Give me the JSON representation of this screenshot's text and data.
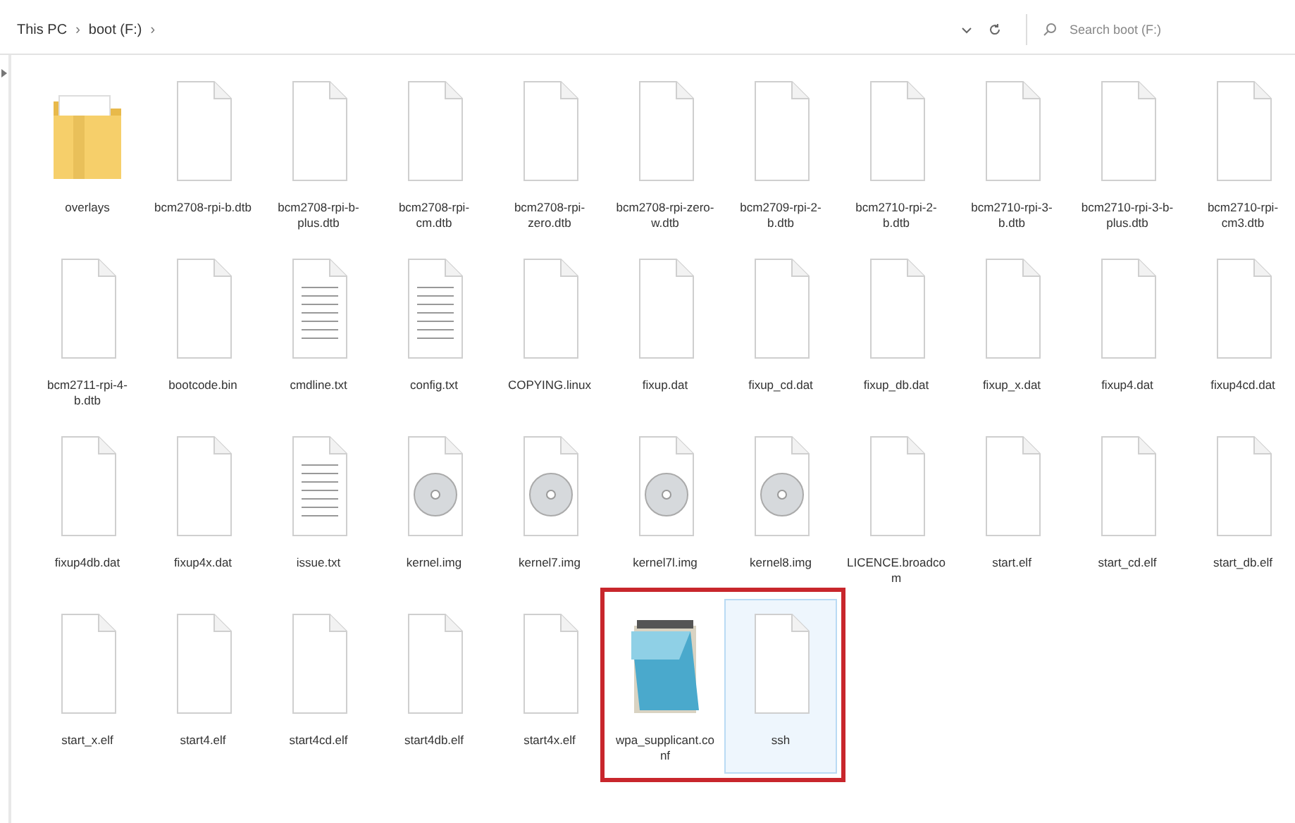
{
  "address_bar": {
    "path": [
      {
        "label": "This PC"
      },
      {
        "label": "boot (F:)"
      }
    ],
    "separator": "›"
  },
  "search": {
    "placeholder": "Search boot (F:)"
  },
  "items": [
    {
      "name": "overlays",
      "kind": "folder",
      "selected": false,
      "highlighted": false
    },
    {
      "name": "bcm2708-rpi-b.dtb",
      "kind": "file",
      "selected": false,
      "highlighted": false
    },
    {
      "name": "bcm2708-rpi-b-plus.dtb",
      "kind": "file",
      "selected": false,
      "highlighted": false
    },
    {
      "name": "bcm2708-rpi-cm.dtb",
      "kind": "file",
      "selected": false,
      "highlighted": false
    },
    {
      "name": "bcm2708-rpi-zero.dtb",
      "kind": "file",
      "selected": false,
      "highlighted": false
    },
    {
      "name": "bcm2708-rpi-zero-w.dtb",
      "kind": "file",
      "selected": false,
      "highlighted": false
    },
    {
      "name": "bcm2709-rpi-2-b.dtb",
      "kind": "file",
      "selected": false,
      "highlighted": false
    },
    {
      "name": "bcm2710-rpi-2-b.dtb",
      "kind": "file",
      "selected": false,
      "highlighted": false
    },
    {
      "name": "bcm2710-rpi-3-b.dtb",
      "kind": "file",
      "selected": false,
      "highlighted": false
    },
    {
      "name": "bcm2710-rpi-3-b-plus.dtb",
      "kind": "file",
      "selected": false,
      "highlighted": false
    },
    {
      "name": "bcm2710-rpi-cm3.dtb",
      "kind": "file",
      "selected": false,
      "highlighted": false
    },
    {
      "name": "bcm2711-rpi-4-b.dtb",
      "kind": "file",
      "selected": false,
      "highlighted": false
    },
    {
      "name": "bootcode.bin",
      "kind": "file",
      "selected": false,
      "highlighted": false
    },
    {
      "name": "cmdline.txt",
      "kind": "text",
      "selected": false,
      "highlighted": false
    },
    {
      "name": "config.txt",
      "kind": "text",
      "selected": false,
      "highlighted": false
    },
    {
      "name": "COPYING.linux",
      "kind": "file",
      "selected": false,
      "highlighted": false
    },
    {
      "name": "fixup.dat",
      "kind": "file",
      "selected": false,
      "highlighted": false
    },
    {
      "name": "fixup_cd.dat",
      "kind": "file",
      "selected": false,
      "highlighted": false
    },
    {
      "name": "fixup_db.dat",
      "kind": "file",
      "selected": false,
      "highlighted": false
    },
    {
      "name": "fixup_x.dat",
      "kind": "file",
      "selected": false,
      "highlighted": false
    },
    {
      "name": "fixup4.dat",
      "kind": "file",
      "selected": false,
      "highlighted": false
    },
    {
      "name": "fixup4cd.dat",
      "kind": "file",
      "selected": false,
      "highlighted": false
    },
    {
      "name": "fixup4db.dat",
      "kind": "file",
      "selected": false,
      "highlighted": false
    },
    {
      "name": "fixup4x.dat",
      "kind": "file",
      "selected": false,
      "highlighted": false
    },
    {
      "name": "issue.txt",
      "kind": "text",
      "selected": false,
      "highlighted": false
    },
    {
      "name": "kernel.img",
      "kind": "disc",
      "selected": false,
      "highlighted": false
    },
    {
      "name": "kernel7.img",
      "kind": "disc",
      "selected": false,
      "highlighted": false
    },
    {
      "name": "kernel7l.img",
      "kind": "disc",
      "selected": false,
      "highlighted": false
    },
    {
      "name": "kernel8.img",
      "kind": "disc",
      "selected": false,
      "highlighted": false
    },
    {
      "name": "LICENCE.broadcom",
      "kind": "file",
      "selected": false,
      "highlighted": false
    },
    {
      "name": "start.elf",
      "kind": "file",
      "selected": false,
      "highlighted": false
    },
    {
      "name": "start_cd.elf",
      "kind": "file",
      "selected": false,
      "highlighted": false
    },
    {
      "name": "start_db.elf",
      "kind": "file",
      "selected": false,
      "highlighted": false
    },
    {
      "name": "start_x.elf",
      "kind": "file",
      "selected": false,
      "highlighted": false
    },
    {
      "name": "start4.elf",
      "kind": "file",
      "selected": false,
      "highlighted": false
    },
    {
      "name": "start4cd.elf",
      "kind": "file",
      "selected": false,
      "highlighted": false
    },
    {
      "name": "start4db.elf",
      "kind": "file",
      "selected": false,
      "highlighted": false
    },
    {
      "name": "start4x.elf",
      "kind": "file",
      "selected": false,
      "highlighted": false
    },
    {
      "name": "wpa_supplicant.conf",
      "kind": "notepad",
      "selected": false,
      "highlighted": true
    },
    {
      "name": "ssh",
      "kind": "file",
      "selected": true,
      "highlighted": true
    }
  ]
}
